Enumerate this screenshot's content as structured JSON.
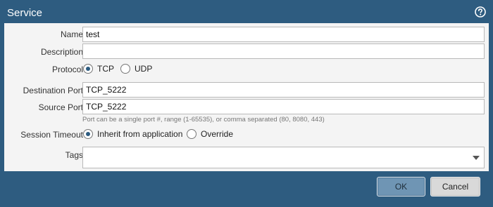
{
  "dialog": {
    "title": "Service",
    "help_icon": "help-circle-icon"
  },
  "form": {
    "name": {
      "label": "Name",
      "value": "test"
    },
    "description": {
      "label": "Description",
      "value": ""
    },
    "protocol": {
      "label": "Protocol",
      "options": [
        {
          "label": "TCP",
          "checked": true
        },
        {
          "label": "UDP",
          "checked": false
        }
      ]
    },
    "destination_port": {
      "label": "Destination Port",
      "value": "TCP_5222"
    },
    "source_port": {
      "label": "Source Port",
      "value": "TCP_5222"
    },
    "port_hint": "Port can be a single port #, range (1-65535), or comma separated (80, 8080, 443)",
    "session_timeout": {
      "label": "Session Timeout",
      "options": [
        {
          "label": "Inherit from application",
          "checked": true
        },
        {
          "label": "Override",
          "checked": false
        }
      ]
    },
    "tags": {
      "label": "Tags",
      "value": ""
    }
  },
  "buttons": {
    "ok": "OK",
    "cancel": "Cancel"
  },
  "colors": {
    "frame": "#2e5c80",
    "panel": "#f4f4f4",
    "ok_button": "#6f95b4"
  }
}
